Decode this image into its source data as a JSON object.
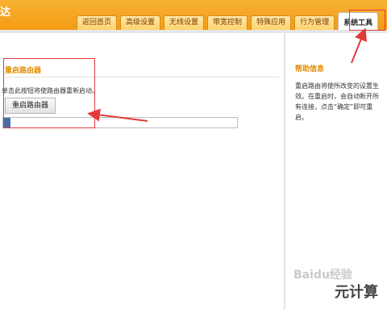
{
  "header": {
    "brand": "达",
    "tabs": [
      {
        "label": "返回首页"
      },
      {
        "label": "高级设置"
      },
      {
        "label": "无线设置"
      },
      {
        "label": "带宽控制"
      },
      {
        "label": "特殊应用"
      },
      {
        "label": "行为管理"
      },
      {
        "label": "系统工具",
        "active": true
      }
    ]
  },
  "main": {
    "section_title": "重启路由器",
    "description": "单击此按钮将使路由器重新启动。",
    "reboot_button": "重启路由器",
    "progress": 0.01
  },
  "help": {
    "title": "帮助信息",
    "text": "重启路由将使所改变的设置生效。在重启时，会自动断开所有连接，点击“确定”即可重启。"
  },
  "watermark": {
    "text": "Baidu经验",
    "site": "元计算"
  },
  "colors": {
    "header": "#f39a12",
    "accent": "#e38b00",
    "annotation": "#e23a3a",
    "progress": "#4a6fa8"
  }
}
